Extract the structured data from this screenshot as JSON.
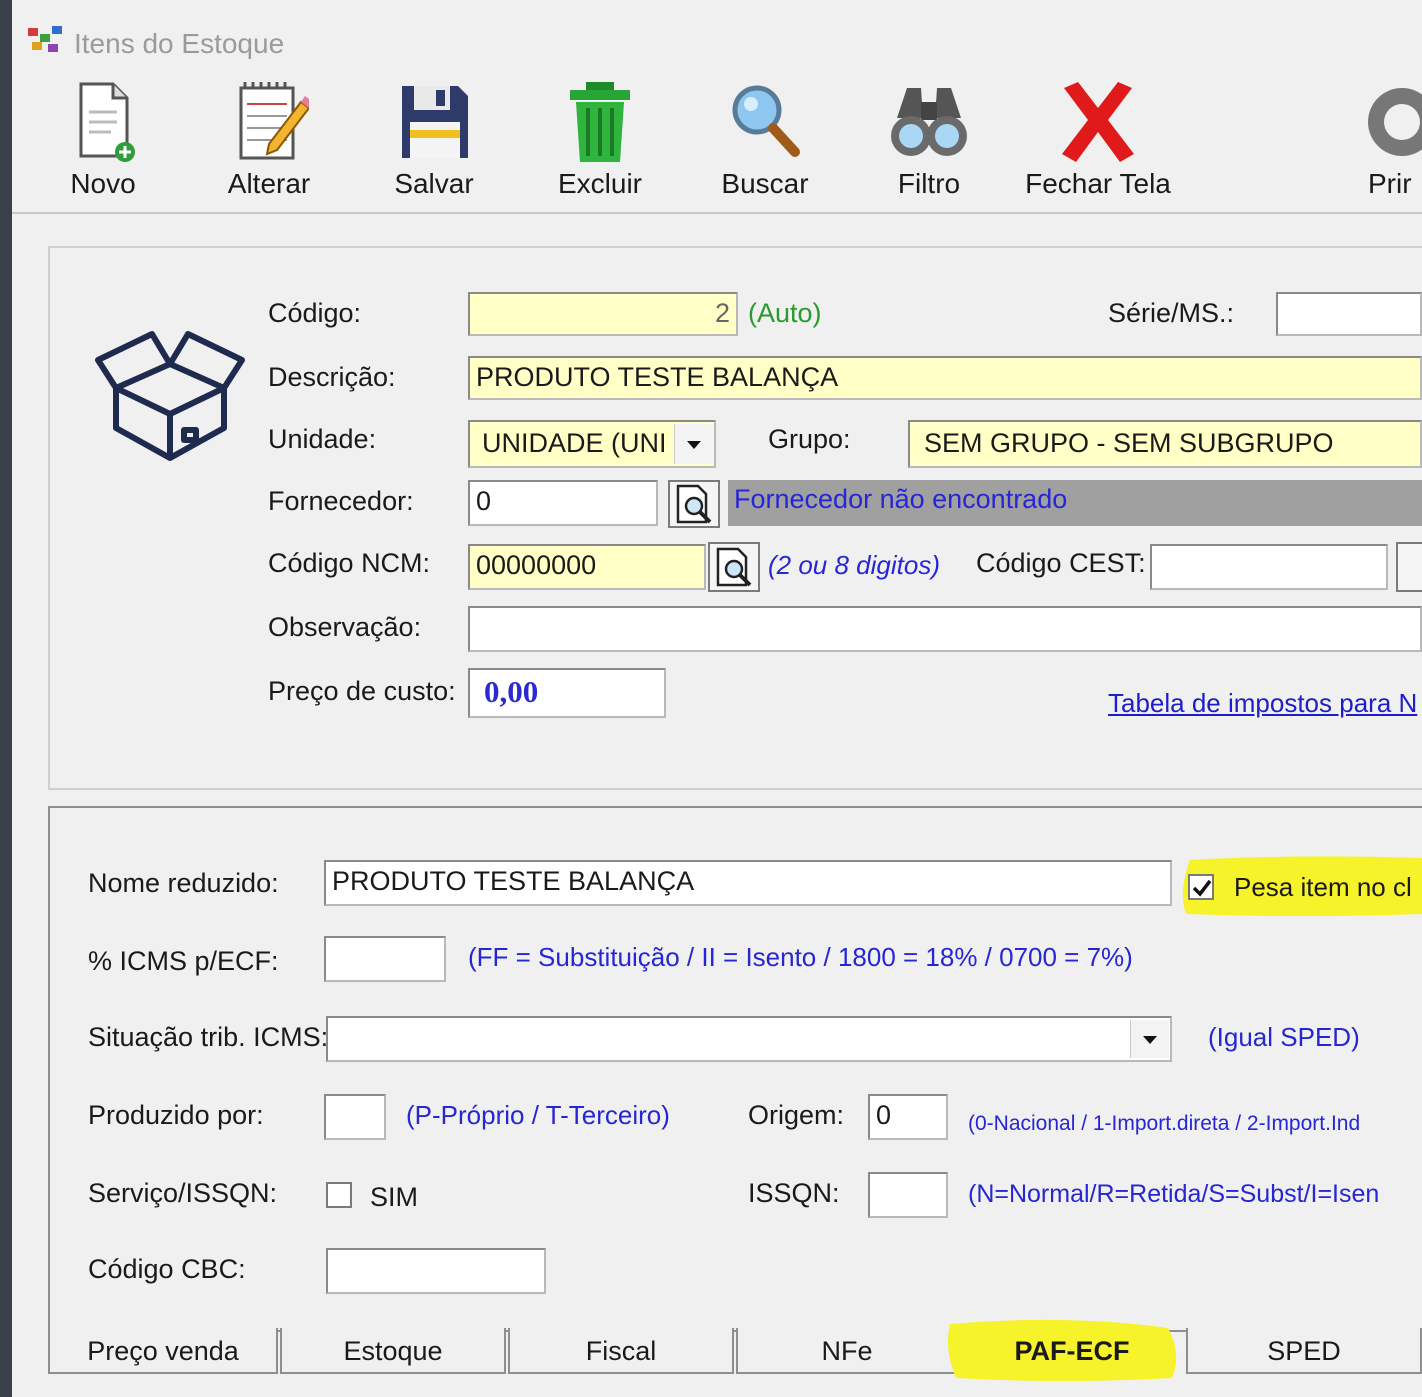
{
  "window": {
    "title": "Itens do Estoque"
  },
  "toolbar": {
    "novo": "Novo",
    "alterar": "Alterar",
    "salvar": "Salvar",
    "excluir": "Excluir",
    "buscar": "Buscar",
    "filtro": "Filtro",
    "fechar": "Fechar Tela",
    "imprimir": "Prir"
  },
  "main": {
    "codigo_label": "Código:",
    "codigo_value": "2",
    "codigo_auto": "(Auto)",
    "serie_label": "Série/MS.:",
    "serie_value": "",
    "descricao_label": "Descrição:",
    "descricao_value": "PRODUTO TESTE BALANÇA",
    "unidade_label": "Unidade:",
    "unidade_value": "UNIDADE (UNI",
    "grupo_label": "Grupo:",
    "grupo_value": "SEM GRUPO - SEM SUBGRUPO",
    "fornecedor_label": "Fornecedor:",
    "fornecedor_value": "0",
    "fornecedor_status": "Fornecedor não encontrado",
    "ncm_label": "Código NCM:",
    "ncm_value": "00000000",
    "ncm_hint": "(2 ou 8 digitos)",
    "cest_label": "Código CEST:",
    "cest_value": "",
    "obs_label": "Observação:",
    "obs_value": "",
    "preco_label": "Preço de custo:",
    "preco_value": "0,00",
    "tabela_link": "Tabela de impostos para N"
  },
  "paf": {
    "nome_label": "Nome reduzido:",
    "nome_value": "PRODUTO TESTE BALANÇA",
    "pesa_label": "Pesa item no cl",
    "pesa_checked": true,
    "icms_label": "% ICMS p/ECF:",
    "icms_value": "",
    "icms_hint": "(FF = Substituição / II = Isento / 1800 = 18% / 0700 = 7%)",
    "sit_label": "Situação trib. ICMS:",
    "sit_value": "",
    "sit_hint": "(Igual SPED)",
    "prod_label": "Produzido por:",
    "prod_value": "",
    "prod_hint": "(P-Próprio / T-Terceiro)",
    "origem_label": "Origem:",
    "origem_value": "0",
    "origem_hint": "(0-Nacional / 1-Import.direta / 2-Import.Ind",
    "servico_label": "Serviço/ISSQN:",
    "servico_sim": "SIM",
    "issqn_label": "ISSQN:",
    "issqn_value": "",
    "issqn_hint": "(N=Normal/R=Retida/S=Subst/I=Isen",
    "cbc_label": "Código CBC:",
    "cbc_value": ""
  },
  "tabs": {
    "preco_venda": "Preço venda",
    "estoque": "Estoque",
    "fiscal": "Fiscal",
    "nfe": "NFe",
    "paf_ecf": "PAF-ECF",
    "sped": "SPED"
  },
  "colors": {
    "highlight": "#f6f32a",
    "field_yellow": "#ffffc6",
    "hint_blue": "#2626d4"
  }
}
